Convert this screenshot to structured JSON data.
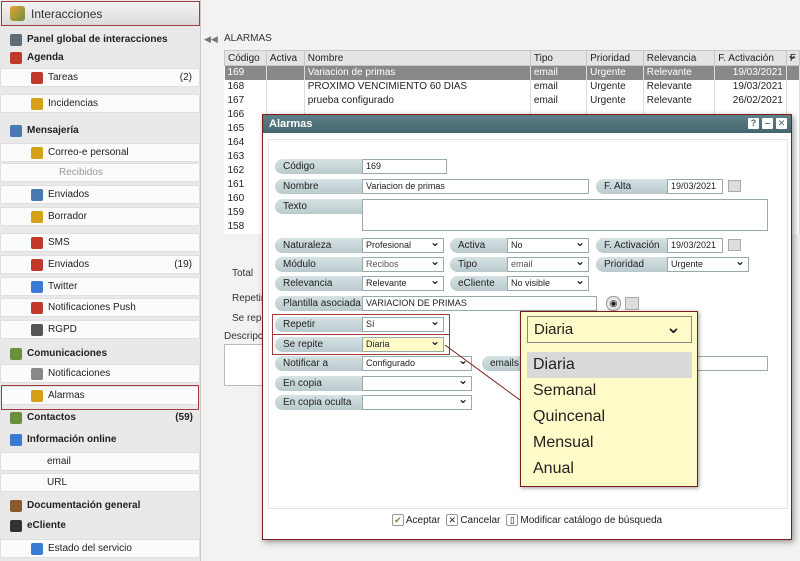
{
  "app": {
    "title": "Interacciones"
  },
  "sidebar": {
    "items": [
      {
        "label": "Panel global de interacciones",
        "type": "section",
        "icon": "dashboard-icon",
        "color": "#5b6b78"
      },
      {
        "label": "Agenda",
        "type": "section",
        "icon": "calendar-icon",
        "color": "#c0392b"
      },
      {
        "label": "Tareas",
        "type": "item",
        "count": "(2)",
        "icon": "task-icon",
        "color": "#c0392b"
      },
      {
        "label": "Incidencias",
        "type": "item",
        "icon": "incident-icon",
        "color": "#d4a017"
      },
      {
        "label": "Mensajería",
        "type": "section",
        "icon": "messaging-icon",
        "color": "#4a78b0"
      },
      {
        "label": "Correo-e personal",
        "type": "item",
        "icon": "mail-icon",
        "color": "#d4a017"
      },
      {
        "label": "Recibidos",
        "type": "item-disabled",
        "icon": "",
        "color": ""
      },
      {
        "label": "Enviados",
        "type": "item",
        "icon": "sent-icon",
        "color": "#4a78b0"
      },
      {
        "label": "Borrador",
        "type": "item",
        "icon": "draft-icon",
        "color": "#d4a017"
      },
      {
        "label": "SMS",
        "type": "item",
        "icon": "sms-icon",
        "color": "#c0392b"
      },
      {
        "label": "Enviados",
        "type": "item",
        "count": "(19)",
        "icon": "sms-sent-icon",
        "color": "#c0392b"
      },
      {
        "label": "Twitter",
        "type": "item",
        "icon": "twitter-icon",
        "color": "#3a7bd5"
      },
      {
        "label": "Notificaciones Push",
        "type": "item",
        "icon": "push-icon",
        "color": "#c0392b"
      },
      {
        "label": "RGPD",
        "type": "item",
        "icon": "rgpd-icon",
        "color": "#555"
      },
      {
        "label": "Comunicaciones",
        "type": "section",
        "icon": "comms-icon",
        "color": "#6b8f3a"
      },
      {
        "label": "Notificaciones",
        "type": "item",
        "icon": "notification-icon",
        "color": "#888"
      },
      {
        "label": "Alarmas",
        "type": "item",
        "icon": "alarm-icon",
        "color": "#d4a017"
      },
      {
        "label": "Contactos",
        "type": "section",
        "count": "(59)",
        "icon": "contacts-icon",
        "color": "#6b8f3a"
      },
      {
        "label": "Información online",
        "type": "section",
        "icon": "globe-icon",
        "color": "#3a7bd5"
      },
      {
        "label": "email",
        "type": "item",
        "icon": "",
        "color": ""
      },
      {
        "label": "URL",
        "type": "item",
        "icon": "",
        "color": ""
      },
      {
        "label": "Documentación general",
        "type": "section",
        "icon": "docs-icon",
        "color": "#8a5a2b"
      },
      {
        "label": "eCliente",
        "type": "section",
        "icon": "ecliente-icon",
        "color": "#333"
      },
      {
        "label": "Estado del servicio",
        "type": "item",
        "icon": "service-icon",
        "color": "#3a7bd5"
      }
    ]
  },
  "main": {
    "title": "ALARMAS",
    "columns": [
      "Código",
      "Activa",
      "Nombre",
      "Tipo",
      "Prioridad",
      "Relevancia",
      "F. Activación",
      "F"
    ],
    "rows": [
      {
        "codigo": "169",
        "activa": "",
        "nombre": "Variacion de primas",
        "tipo": "email",
        "prioridad": "Urgente",
        "relevancia": "Relevante",
        "fecha": "19/03/2021",
        "selected": true
      },
      {
        "codigo": "168",
        "activa": "",
        "nombre": "PROXIMO VENCIMIENTO 60 DIAS",
        "tipo": "email",
        "prioridad": "Urgente",
        "relevancia": "Relevante",
        "fecha": "19/03/2021"
      },
      {
        "codigo": "167",
        "activa": "",
        "nombre": "prueba configurado",
        "tipo": "email",
        "prioridad": "Urgente",
        "relevancia": "Relevante",
        "fecha": "26/02/2021"
      },
      {
        "codigo": "166"
      },
      {
        "codigo": "165"
      },
      {
        "codigo": "164"
      },
      {
        "codigo": "163"
      },
      {
        "codigo": "162"
      },
      {
        "codigo": "161"
      },
      {
        "codigo": "160"
      },
      {
        "codigo": "159"
      },
      {
        "codigo": "158"
      }
    ],
    "total_label": "Total",
    "behind_labels": {
      "repetir": "Repetir",
      "se_repite": "Se repit",
      "descripcion": "Descripci"
    }
  },
  "modal": {
    "title": "Alarmas",
    "window_buttons": [
      "?",
      "–",
      "✕"
    ],
    "fields": {
      "codigo": {
        "label": "Código",
        "value": "169"
      },
      "nombre": {
        "label": "Nombre",
        "value": "Variacion de primas"
      },
      "f_alta": {
        "label": "F. Alta",
        "value": "19/03/2021"
      },
      "texto": {
        "label": "Texto",
        "value": ""
      },
      "naturaleza": {
        "label": "Naturaleza",
        "value": "Profesional"
      },
      "activa": {
        "label": "Activa",
        "value": "No"
      },
      "f_activacion": {
        "label": "F. Activación",
        "value": "19/03/2021"
      },
      "modulo": {
        "label": "Módulo",
        "value": "Recibos"
      },
      "tipo": {
        "label": "Tipo",
        "value": "email"
      },
      "prioridad": {
        "label": "Prioridad",
        "value": "Urgente"
      },
      "relevancia": {
        "label": "Relevancia",
        "value": "Relevante"
      },
      "ecliente": {
        "label": "eCliente",
        "value": "No visible"
      },
      "plantilla": {
        "label": "Plantilla asociada",
        "value": "VARIACION DE PRIMAS"
      },
      "repetir": {
        "label": "Repetir",
        "value": "Sí"
      },
      "se_repite": {
        "label": "Se repite",
        "value": "Diaria"
      },
      "notificar": {
        "label": "Notificar a",
        "value": "Configurado"
      },
      "emails": {
        "label": "emails",
        "value": ""
      },
      "en_copia": {
        "label": "En copia",
        "value": ""
      },
      "en_copia_oculta": {
        "label": "En copia oculta",
        "value": ""
      }
    },
    "footer": {
      "accept": "Aceptar",
      "cancel": "Cancelar",
      "catalog": "Modificar catálogo de búsqueda"
    }
  },
  "zoom_dropdown": {
    "selected": "Diaria",
    "options": [
      "Diaria",
      "Semanal",
      "Quincenal",
      "Mensual",
      "Anual"
    ]
  }
}
